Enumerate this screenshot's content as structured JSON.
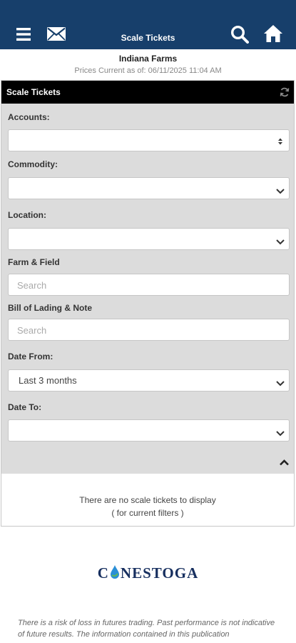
{
  "header": {
    "title": "Scale Tickets",
    "icons": [
      "menu-icon",
      "mail-icon",
      "search-icon",
      "home-icon"
    ],
    "color": "#173f6b"
  },
  "org": {
    "name": "Indiana Farms",
    "prices_current": "Prices Current as of: 06/11/2025 11:04 AM"
  },
  "panel": {
    "title": "Scale Tickets",
    "filters": {
      "accounts_label": "Accounts:",
      "accounts_value": "",
      "commodity_label": "Commodity:",
      "commodity_value": "",
      "location_label": "Location:",
      "location_value": "",
      "farm_field_label": "Farm & Field",
      "farm_field_placeholder": "Search",
      "bol_label": "Bill of Lading & Note",
      "bol_placeholder": "Search",
      "date_from_label": "Date From:",
      "date_from_value": "Last 3 months",
      "date_to_label": "Date To:",
      "date_to_value": ""
    },
    "empty_line1": "There are no scale tickets to display",
    "empty_line2": "( for current filters )"
  },
  "footer": {
    "logo_pre": "C",
    "logo_post": "NESTOGA",
    "disclaimer": "There is a risk of loss in futures trading. Past performance is not indicative of future results. The information contained in this publication"
  }
}
